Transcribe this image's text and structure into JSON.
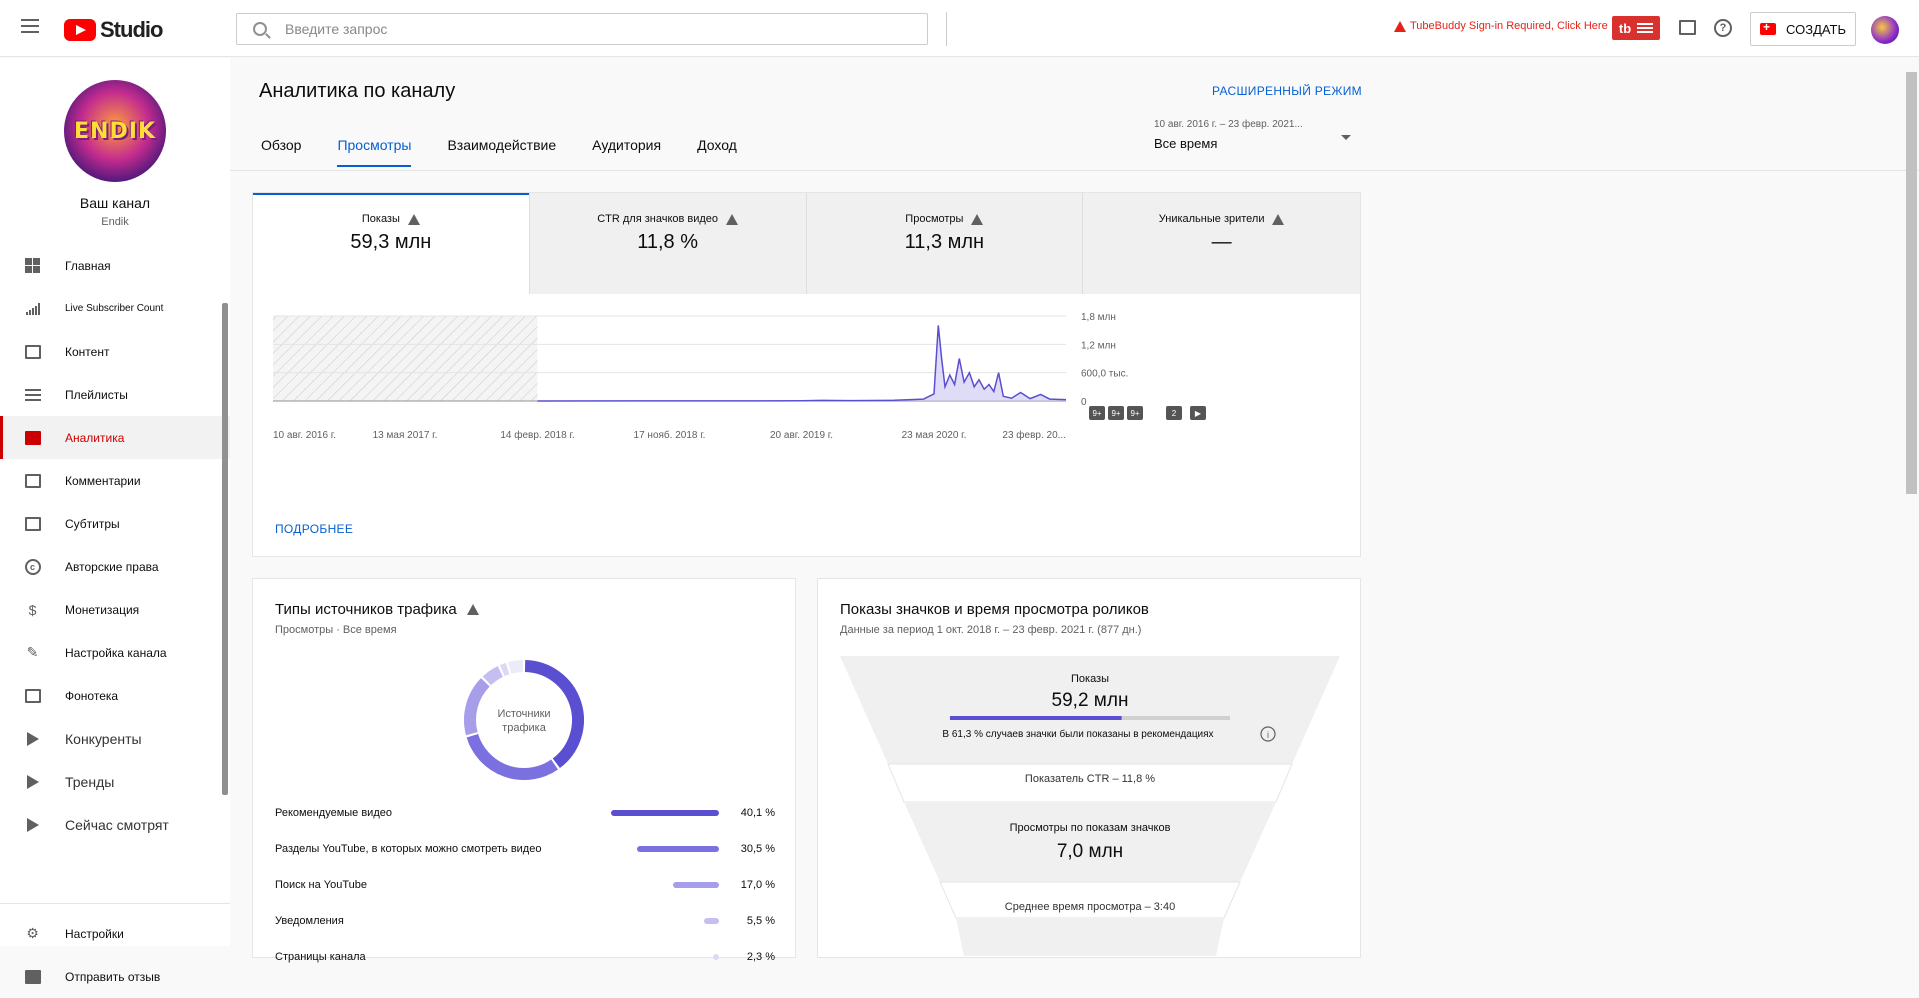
{
  "header": {
    "logo_text": "Studio",
    "search_placeholder": "Введите запрос",
    "tubebuddy_warning": "TubeBuddy Sign-in Required, Click Here",
    "tubebuddy_label": "tb",
    "help_label": "?",
    "create_label": "СОЗДАТЬ"
  },
  "sidebar": {
    "avatar_text": "ENDIK",
    "channel_title": "Ваш канал",
    "channel_name": "Endik",
    "items": [
      {
        "label": "Главная",
        "icon": "dashboard-icon"
      },
      {
        "label": "Live Subscriber Count",
        "icon": "signal-bars-icon"
      },
      {
        "label": "Контент",
        "icon": "video-library-icon"
      },
      {
        "label": "Плейлисты",
        "icon": "playlist-icon"
      },
      {
        "label": "Аналитика",
        "icon": "analytics-icon"
      },
      {
        "label": "Комментарии",
        "icon": "comment-icon"
      },
      {
        "label": "Субтитры",
        "icon": "subtitles-icon"
      },
      {
        "label": "Авторские права",
        "icon": "copyright-icon"
      },
      {
        "label": "Монетизация",
        "icon": "dollar-icon"
      },
      {
        "label": "Настройка канала",
        "icon": "magic-wand-icon"
      },
      {
        "label": "Фонотека",
        "icon": "audio-library-icon"
      },
      {
        "label": "Конкуренты",
        "icon": "tubebuddy-play-icon"
      },
      {
        "label": "Тренды",
        "icon": "tubebuddy-play-icon"
      },
      {
        "label": "Сейчас смотрят",
        "icon": "tubebuddy-play-icon"
      }
    ],
    "bottom": [
      {
        "label": "Настройки",
        "icon": "gear-icon"
      },
      {
        "label": "Отправить отзыв",
        "icon": "feedback-icon"
      }
    ]
  },
  "main": {
    "title": "Аналитика по каналу",
    "advanced_mode": "РАСШИРЕННЫЙ РЕЖИМ",
    "tabs": [
      "Обзор",
      "Просмотры",
      "Взаимодействие",
      "Аудитория",
      "Доход"
    ],
    "active_tab": "Просмотры",
    "date_range": "10 авг. 2016 г. – 23 февр. 2021...",
    "date_period": "Все время",
    "metrics": [
      {
        "label": "Показы",
        "value": "59,3 млн"
      },
      {
        "label": "CTR для значков видео",
        "value": "11,8 %"
      },
      {
        "label": "Просмотры",
        "value": "11,3 млн"
      },
      {
        "label": "Уникальные зрители",
        "value": "—"
      }
    ],
    "more_link": "ПОДРОБНЕЕ"
  },
  "chart_data": {
    "type": "line",
    "series": [
      {
        "name": "Показы",
        "color": "#5b4fd1"
      }
    ],
    "x_ticks": [
      "10 авг. 2016 г.",
      "13 мая 2017 г.",
      "14 февр. 2018 г.",
      "17 нояб. 2018 г.",
      "20 авг. 2019 г.",
      "23 мая 2020 г.",
      "23 февр. 20..."
    ],
    "y_ticks": [
      "1,8 млн",
      "1,2 млн",
      "600,0 тыс.",
      "0"
    ],
    "ylim": [
      0,
      1800000
    ],
    "no_data_range": [
      "10 авг. 2016 г.",
      "14 февр. 2018 г."
    ],
    "points": [
      [
        "2018-02-14",
        0
      ],
      [
        "2019-01-01",
        3000
      ],
      [
        "2019-08-20",
        5000
      ],
      [
        "2019-10-01",
        12000
      ],
      [
        "2019-12-01",
        8000
      ],
      [
        "2020-03-01",
        15000
      ],
      [
        "2020-05-01",
        40000
      ],
      [
        "2020-05-23",
        150000
      ],
      [
        "2020-06-01",
        1600000
      ],
      [
        "2020-06-08",
        900000
      ],
      [
        "2020-06-15",
        300000
      ],
      [
        "2020-06-25",
        550000
      ],
      [
        "2020-07-05",
        350000
      ],
      [
        "2020-07-15",
        900000
      ],
      [
        "2020-07-25",
        400000
      ],
      [
        "2020-08-05",
        600000
      ],
      [
        "2020-08-15",
        300000
      ],
      [
        "2020-08-25",
        450000
      ],
      [
        "2020-09-05",
        250000
      ],
      [
        "2020-09-15",
        350000
      ],
      [
        "2020-09-25",
        200000
      ],
      [
        "2020-10-05",
        600000
      ],
      [
        "2020-10-15",
        100000
      ],
      [
        "2020-11-01",
        60000
      ],
      [
        "2020-11-20",
        180000
      ],
      [
        "2020-12-10",
        50000
      ],
      [
        "2021-01-01",
        140000
      ],
      [
        "2021-01-20",
        40000
      ],
      [
        "2021-02-23",
        30000
      ]
    ],
    "markers": [
      "9+",
      "9+",
      "9+",
      "2",
      "▶"
    ],
    "grid": true
  },
  "traffic": {
    "title": "Типы источников трафика",
    "subtitle": "Просмотры · Все время",
    "donut_label": "Источники трафика",
    "rows": [
      {
        "label": "Рекомендуемые видео",
        "pct": "40,1 %",
        "value": 40.1,
        "color": "#5b4fd1"
      },
      {
        "label": "Разделы YouTube, в которых можно смотреть видео",
        "pct": "30,5 %",
        "value": 30.5,
        "color": "#7b70e0"
      },
      {
        "label": "Поиск на YouTube",
        "pct": "17,0 %",
        "value": 17.0,
        "color": "#a69ee8"
      },
      {
        "label": "Уведомления",
        "pct": "5,5 %",
        "value": 5.5,
        "color": "#c4bff0"
      },
      {
        "label": "Страницы канала",
        "pct": "2,3 %",
        "value": 2.3,
        "color": "#dcd9f6"
      }
    ]
  },
  "funnel": {
    "title": "Показы значков и время просмотра роликов",
    "subtitle": "Данные за период 1 окт. 2018 г. – 23 февр. 2021 г. (877 дн.)",
    "impressions_label": "Показы",
    "impressions_value": "59,2 млн",
    "impressions_progress": 0.613,
    "recommend_note": "В 61,3 % случаев значки были показаны в рекомендациях",
    "ctr_label": "Показатель CTR – 11,8 %",
    "views_label": "Просмотры по показам значков",
    "views_value": "7,0 млн",
    "avg_duration": "Среднее время просмотра – 3:40"
  }
}
